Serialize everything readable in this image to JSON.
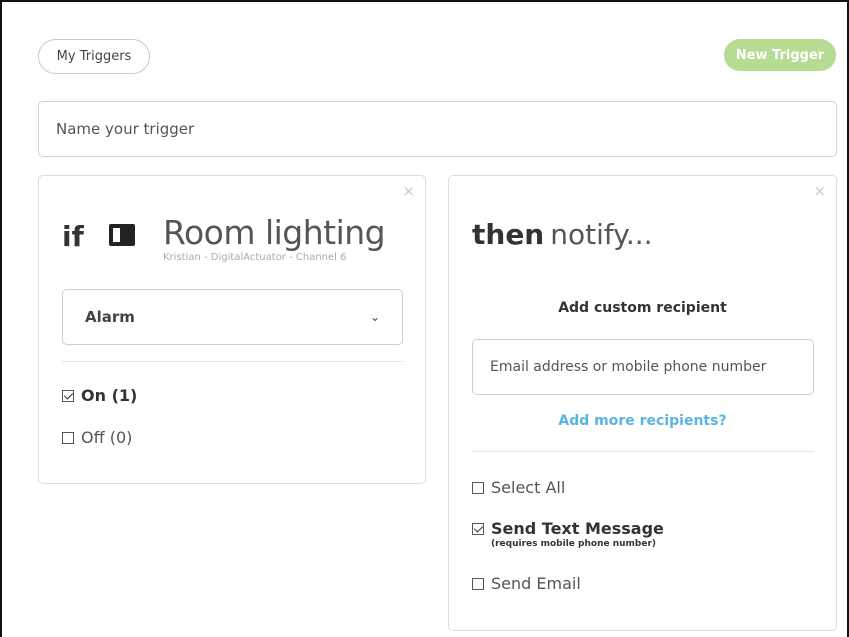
{
  "header": {
    "my_triggers_label": "My Triggers",
    "new_trigger_label": "New Trigger"
  },
  "trigger_name": {
    "placeholder": "Name your trigger",
    "value": ""
  },
  "condition": {
    "if_label": "if",
    "device_icon": "device-icon",
    "device_name": "Room lighting",
    "device_subtitle": "Kristian - DigitalActuator - Channel 6",
    "selected_event": "Alarm",
    "options": [
      {
        "label": "On (1)",
        "checked": true
      },
      {
        "label": "Off (0)",
        "checked": false
      }
    ]
  },
  "action": {
    "then_label": "then",
    "notify_label": "notify...",
    "add_custom_label": "Add custom recipient",
    "recipient_placeholder": "Email address or mobile phone number",
    "add_more_label": "Add more recipients?",
    "options": [
      {
        "label": "Select All",
        "checked": false,
        "note": ""
      },
      {
        "label": "Send Text Message",
        "checked": true,
        "note": "(requires mobile phone number)"
      },
      {
        "label": "Send Email",
        "checked": false,
        "note": ""
      }
    ]
  },
  "close_glyph": "×",
  "colors": {
    "new_trigger_bg": "#b5dc92",
    "link_blue": "#5bb3e0",
    "border": "#dcdcdc"
  }
}
